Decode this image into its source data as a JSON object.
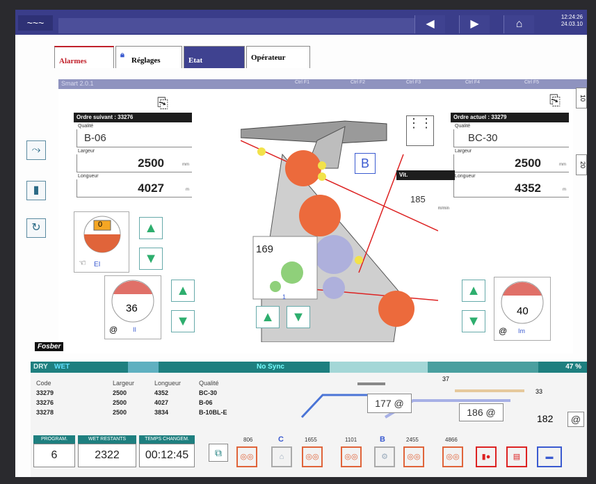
{
  "topbar": {
    "logo": "~~~",
    "nav_back": "◀",
    "nav_forward": "▶",
    "home": "⌂",
    "time": "12:24:26",
    "date": "24.03.10"
  },
  "tabs": [
    {
      "label": "Alarmes"
    },
    {
      "label": "Réglages"
    },
    {
      "label": "Etat"
    },
    {
      "label": "Opérateur"
    }
  ],
  "subbar": {
    "label": "Smart 2.0.1",
    "ctrl": [
      "Ctrl F1",
      "Ctrl F2",
      "Ctrl F3",
      "Ctrl F4",
      "Ctrl F5"
    ]
  },
  "right_edge": {
    "top": "10",
    "mid": "20"
  },
  "next_order": {
    "header": "Ordre suivant : 33276",
    "quality_label": "Qualité",
    "quality": "B-06",
    "width_label": "Largeur",
    "width": "2500",
    "width_unit": "mm",
    "length_label": "Longueur",
    "length": "4027",
    "length_unit": "m"
  },
  "current_order": {
    "header": "Ordre actuel : 33279",
    "quality_label": "Qualité",
    "quality": "BC-30",
    "width_label": "Largeur",
    "width": "2500",
    "width_unit": "mm",
    "length_label": "Longueur",
    "length": "4352",
    "length_unit": "m"
  },
  "gauges": {
    "ei": {
      "value": "0",
      "label": "EI"
    },
    "ii": {
      "value": "36",
      "label": "II"
    },
    "im": {
      "value": "40",
      "label": "Im"
    }
  },
  "machine": {
    "badge": "B",
    "splice_counter": "169",
    "splice_sub": "1"
  },
  "speed": {
    "label": "Vit.",
    "value": "185",
    "unit": "m/min"
  },
  "brand": "Fosber",
  "status": {
    "dry": "DRY",
    "wet": "WET",
    "sync": "No Sync",
    "percent": "47 %",
    "progress": 0.47
  },
  "orders_table": {
    "headers": [
      "Code",
      "Largeur",
      "Longueur",
      "Qualité"
    ],
    "rows": [
      [
        "33279",
        "2500",
        "4352",
        "BC-30"
      ],
      [
        "33276",
        "2500",
        "4027",
        "B-06"
      ],
      [
        "33278",
        "2500",
        "3834",
        "B-10BL-E"
      ]
    ]
  },
  "counters": {
    "c37": "37",
    "c177": "177",
    "c33": "33",
    "c186": "186",
    "c182": "182"
  },
  "program": {
    "program_label": "PROGRAM.",
    "program_value": "6",
    "wet_label": "WET RESTANTS",
    "wet_value": "2322",
    "time_label": "TEMPS CHANGEM.",
    "time_value": "00:12:45"
  },
  "modules": [
    {
      "num": "806"
    },
    {
      "letter": "C"
    },
    {
      "num": "1655"
    },
    {
      "num": "1101"
    },
    {
      "letter": "B"
    },
    {
      "num": "2455"
    },
    {
      "num": "4866"
    }
  ]
}
